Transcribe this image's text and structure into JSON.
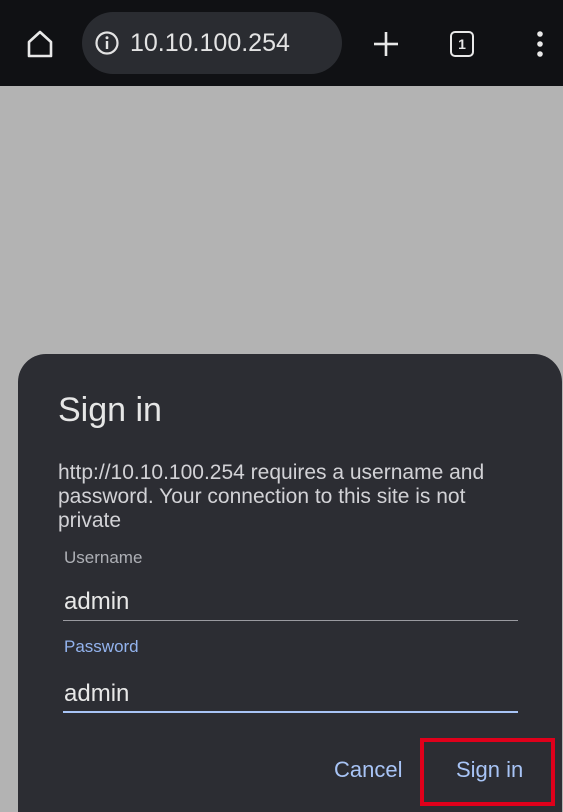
{
  "browser": {
    "url": "10.10.100.254",
    "tab_count": "1",
    "icons": {
      "home": "home-icon",
      "info": "info-icon",
      "new_tab": "plus-icon",
      "tabs": "tab-switcher-icon",
      "menu": "more-vert-icon"
    }
  },
  "dialog": {
    "title": "Sign in",
    "message": "http://10.10.100.254 requires a username and password. Your connection to this site is not private",
    "username_label": "Username",
    "username_value": "admin",
    "password_label": "Password",
    "password_value": "admin",
    "cancel_label": "Cancel",
    "signin_label": "Sign in"
  },
  "colors": {
    "page_background": "#b3b3b3",
    "toolbar": "#101114",
    "dialog_background": "#2c2d33",
    "accent": "#a8c4f6",
    "highlight": "#e0001b"
  }
}
